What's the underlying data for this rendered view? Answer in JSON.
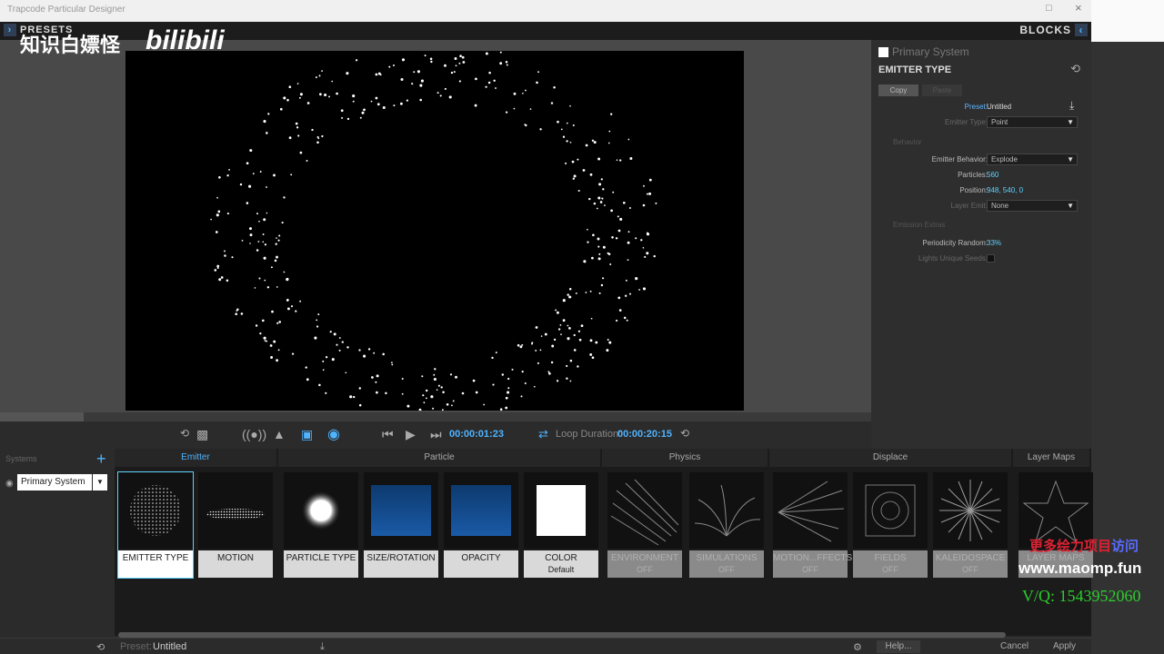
{
  "window": {
    "title": "Trapcode Particular Designer",
    "restore_icon": "□",
    "close_icon": "×"
  },
  "topbar": {
    "presets_label": "PRESETS",
    "blocks_label": "BLOCKS"
  },
  "watermark": {
    "text": "知识白嫖怪",
    "brand": "bilibili"
  },
  "viewer": {
    "particle_color": "#ffffff"
  },
  "transport": {
    "timecode": "00:00:01:23",
    "loop_label": "Loop Duration:",
    "loop_value": "00:00:20:15"
  },
  "right_panel": {
    "system_name": "Primary System",
    "block_title": "EMITTER TYPE",
    "copy_label": "Copy",
    "paste_label": "Paste",
    "preset_label": "Preset:",
    "preset_value": "Untitled",
    "emitter_type_label": "Emitter Type:",
    "emitter_type_value": "Point",
    "behavior_section": "Behavior",
    "emitter_behavior_label": "Emitter Behavior:",
    "emitter_behavior_value": "Explode",
    "particles_label": "Particles:",
    "particles_value": "560",
    "position_label": "Position:",
    "position_value": "948, 540, 0",
    "layer_label": "Layer Emit:",
    "layer_value": "None",
    "emission_section": "Emission Extras",
    "periodicity_label": "Periodicity Random:",
    "periodicity_value": "33%",
    "unique_seeds_label": "Lights Unique Seeds:"
  },
  "systems": {
    "header": "Systems",
    "selected": "Primary System"
  },
  "groups": {
    "emitter": "Emitter",
    "particle": "Particle",
    "physics": "Physics",
    "displace": "Displace",
    "layer_maps": "Layer Maps"
  },
  "tiles": {
    "emitter_type": "EMITTER TYPE",
    "motion": "MOTION",
    "particle_type": "PARTICLE TYPE",
    "size_rotation": "SIZE/ROTATION",
    "opacity": "OPACITY",
    "color": "COLOR",
    "color_sub": "Default",
    "environment": "ENVIRONMENT",
    "environment_sub": "OFF",
    "simulations": "SIMULATIONS",
    "simulations_sub": "OFF",
    "motion_effects": "MOTION...FFECTS",
    "motion_effects_sub": "OFF",
    "fields": "FIELDS",
    "fields_sub": "OFF",
    "kaleidospace": "KALEIDOSPACE",
    "kaleidospace_sub": "OFF",
    "layer_maps": "LAYER MAPS"
  },
  "statusbar": {
    "preset_label": "Preset:",
    "preset_value": "Untitled",
    "help": "Help...",
    "cancel": "Cancel",
    "apply": "Apply"
  },
  "overlay": {
    "line1_red": "更多绘力项目",
    "line1_blue": "访问",
    "url": "www.maomp.fun",
    "vq": "V/Q:  1543952060"
  }
}
